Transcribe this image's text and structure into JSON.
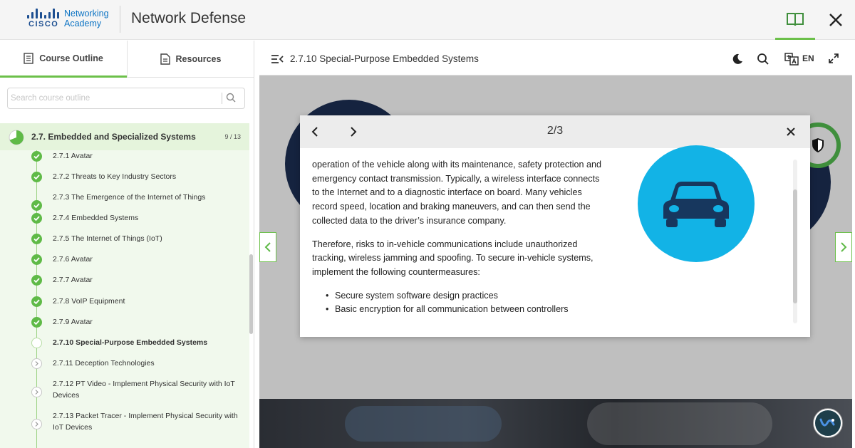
{
  "header": {
    "brand_line1": "Networking",
    "brand_line2": "Academy",
    "cisco_word": "CISCO",
    "title": "Network Defense",
    "icons": [
      "book-icon",
      "close-icon"
    ]
  },
  "sidebar": {
    "tabs": [
      {
        "label": "Course Outline",
        "icon": "outline-icon",
        "active": true
      },
      {
        "label": "Resources",
        "icon": "document-icon",
        "active": false
      }
    ],
    "search_placeholder": "Search course outline",
    "section": {
      "title": "2.7. Embedded and Specialized Systems",
      "count": "9 / 13",
      "progress": 0.69
    },
    "items": [
      {
        "label": "2.7.1 Avatar",
        "status": "done"
      },
      {
        "label": "2.7.2 Threats to Key Industry Sectors",
        "status": "done"
      },
      {
        "label": "2.7.3 The Emergence of the Internet of Things",
        "status": "done"
      },
      {
        "label": "2.7.4 Embedded Systems",
        "status": "done"
      },
      {
        "label": "2.7.5 The Internet of Things (IoT)",
        "status": "done"
      },
      {
        "label": "2.7.6 Avatar",
        "status": "done"
      },
      {
        "label": "2.7.7 Avatar",
        "status": "done"
      },
      {
        "label": "2.7.8 VoIP Equipment",
        "status": "done"
      },
      {
        "label": "2.7.9 Avatar",
        "status": "done"
      },
      {
        "label": "2.7.10 Special-Purpose Embedded Systems",
        "status": "current"
      },
      {
        "label": "2.7.11 Deception Technologies",
        "status": "todo"
      },
      {
        "label": "2.7.12 PT Video - Implement Physical Security with IoT Devices",
        "status": "todo"
      },
      {
        "label": "2.7.13 Packet Tracer - Implement Physical Security with IoT Devices",
        "status": "todo"
      }
    ]
  },
  "content": {
    "page_title": "2.7.10 Special-Purpose Embedded Systems",
    "language": "EN",
    "toolbar_icons": [
      "menu-collapse-icon",
      "moon-icon",
      "search-icon",
      "translate-icon",
      "expand-icon"
    ]
  },
  "modal": {
    "pager": "2/3",
    "paragraphs": [
      "operation of the vehicle along with its maintenance, safety protection and emergency contact transmission. Typically, a wireless interface connects to the Internet and to a diagnostic interface on board. Many vehicles record speed, location and braking maneuvers, and can then send the collected data to the driver’s insurance company.",
      "Therefore, risks to in-vehicle communications include unauthorized tracking, wireless jamming and spoofing. To secure in-vehicle systems, implement the following countermeasures:"
    ],
    "bullets": [
      "Secure system software design practices",
      "Basic encryption for all communication between controllers"
    ],
    "image_icon": "car-icon"
  },
  "colors": {
    "accent_green": "#6cc04a",
    "done_green": "#5fba47",
    "section_bg": "#e5f4dc",
    "car_circle": "#12b3e6",
    "car_color": "#17375e"
  }
}
